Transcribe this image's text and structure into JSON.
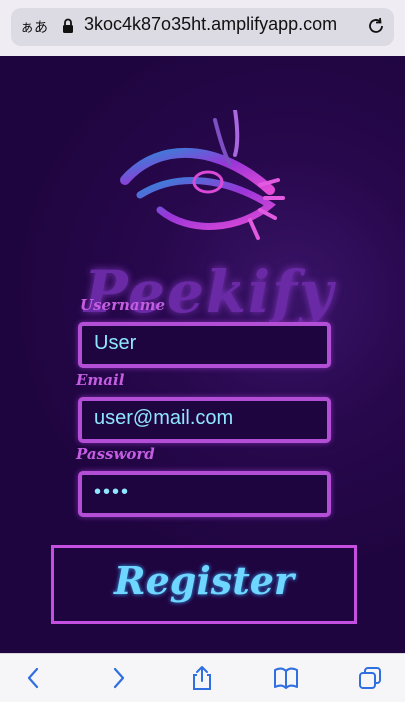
{
  "browser": {
    "text_size_label": "ぁあ",
    "url": "3koc4k87o35ht.amplifyapp.com"
  },
  "app": {
    "brand": "Peekify",
    "form": {
      "username_label": "Username",
      "username_value": "User",
      "email_label": "Email",
      "email_value": "user@mail.com",
      "password_label": "Password",
      "password_value": "••••",
      "register_label": "Register"
    }
  },
  "toolbar": {
    "icons": [
      "back-icon",
      "forward-icon",
      "share-icon",
      "bookmarks-icon",
      "tabs-icon"
    ]
  },
  "colors": {
    "background": "#1f0540",
    "accent": "#b24fd6",
    "input_text": "#8ee6ff",
    "brand": "#6a2aa6"
  }
}
